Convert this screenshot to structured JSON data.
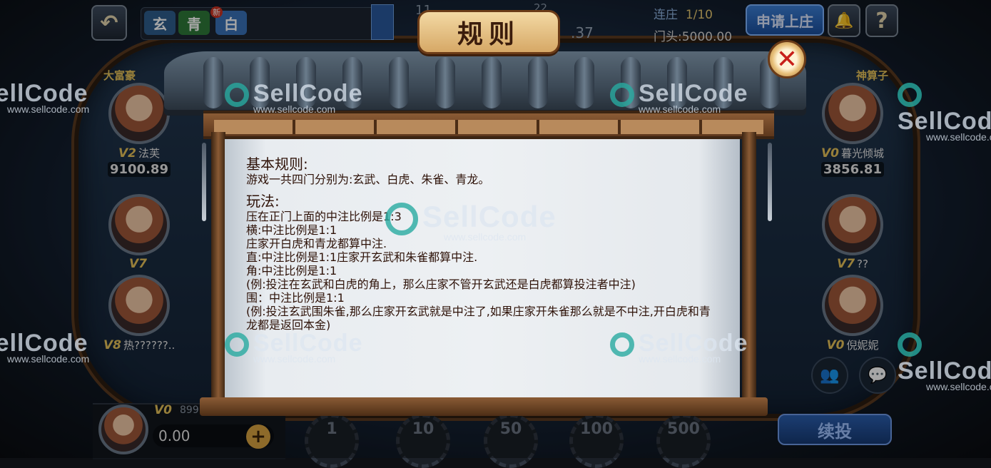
{
  "top_bar": {
    "back_icon": "↶",
    "tabs": [
      "玄",
      "青",
      "白"
    ],
    "new_badge": "新",
    "partial_nums": [
      "11",
      "22",
      ".37"
    ],
    "banker_streak_label": "连庄",
    "banker_streak_value": "1/10",
    "threshold_label": "门头:",
    "threshold_value": "5000.00",
    "apply_banker": "申请上庄",
    "bell_icon": "🔔",
    "help_icon": "?"
  },
  "players_left": [
    {
      "vip": "V2",
      "name": "法芙",
      "balance": "9100.89",
      "badge": "大富豪"
    },
    {
      "vip": "V7",
      "name": "",
      "balance": ""
    },
    {
      "vip": "V8",
      "name": "热??????...",
      "balance": ""
    }
  ],
  "players_right": [
    {
      "vip": "V0",
      "name": "暮光倾城",
      "balance": "3856.81",
      "badge": "神算子"
    },
    {
      "vip": "V7",
      "name": "??",
      "balance": ""
    },
    {
      "vip": "V0",
      "name": "倪妮妮",
      "balance": ""
    }
  ],
  "self": {
    "vip": "V0",
    "id_partial": "899",
    "balance": "0.00",
    "add_icon": "+"
  },
  "chips": [
    "1",
    "10",
    "50",
    "100",
    "500"
  ],
  "continue_bet": "续投",
  "side_buttons": {
    "people_icon": "👥",
    "chat_icon": "💬"
  },
  "modal": {
    "title": "规则",
    "close_icon": "✕",
    "sections": [
      {
        "heading": "基本规则:",
        "lines": [
          "游戏一共四门分别为:玄武、白虎、朱雀、青龙。"
        ]
      },
      {
        "heading": "玩法:",
        "lines": [
          "压在正门上面的中注比例是1:3",
          "横:中注比例是1:1",
          "庄家开白虎和青龙都算中注.",
          "直:中注比例是1:1庄家开玄武和朱雀都算中注.",
          "角:中注比例是1:1",
          "(例:投注在玄武和白虎的角上，那么庄家不管开玄武还是白虎都算投注者中注)",
          "围：中注比例是1:1",
          "(例:投注玄武围朱雀,那么庄家开玄武就是中注了,如果庄家开朱雀那么就是不中注,开白虎和青龙都是返回本金)"
        ]
      }
    ]
  },
  "watermark": {
    "brand": "SellCode",
    "url": "www.sellcode.com"
  }
}
